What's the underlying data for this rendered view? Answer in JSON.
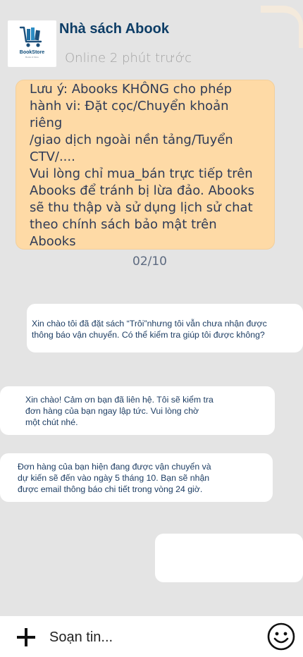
{
  "header": {
    "logo_brand": "BookStore",
    "logo_tagline": "Books & More",
    "shop_name": "Nhà sách Abook",
    "status": "Online 2 phút trước"
  },
  "notice": {
    "text": "Lưu ý: Abooks KHÔNG cho phép\nhành vi: Đặt cọc/Chuyển khoản\nriêng\n/giao dịch ngoài nền tảng/Tuyển\nCTV/....\nVui lòng chỉ mua_bán trực tiếp trên\nAbooks để tránh bị lừa đảo. Abooks\nsẽ thu thập và sử dụng lịch sử chat\ntheo chính sách bảo mật trên\nAbooks"
  },
  "date_label": "02/10",
  "messages": [
    {
      "sender": "user",
      "text": "Xin chào tôi đã đặt sách “Trôi”nhưng tôi vẫn chưa nhận được\nthông báo vận chuyển. Có thể kiểm tra giúp tôi được không?"
    },
    {
      "sender": "shop",
      "text": "Xin chào! Cảm ơn bạn đã liên hệ. Tôi sẽ kiểm tra\nđơn hàng của bạn ngay lập tức. Vui lòng chờ\nmột chút nhé."
    },
    {
      "sender": "shop",
      "text": "Đơn hàng của bạn hiện đang được vận chuyển và\ndự kiến sẽ đến vào ngày 5 tháng 10. Bạn sẽ nhận\nđược email thông báo chi tiết trong vòng 24 giờ."
    },
    {
      "sender": "user",
      "text": ""
    }
  ],
  "composer": {
    "placeholder": "Soạn tin...",
    "add_icon": "plus-icon",
    "emoji_icon": "smiley-icon"
  },
  "colors": {
    "chat_background": "#e4e4e4",
    "notice_background": "#fedaa6",
    "shop_name": "#0d3d66",
    "logo_blue": "#1f6fa3"
  }
}
